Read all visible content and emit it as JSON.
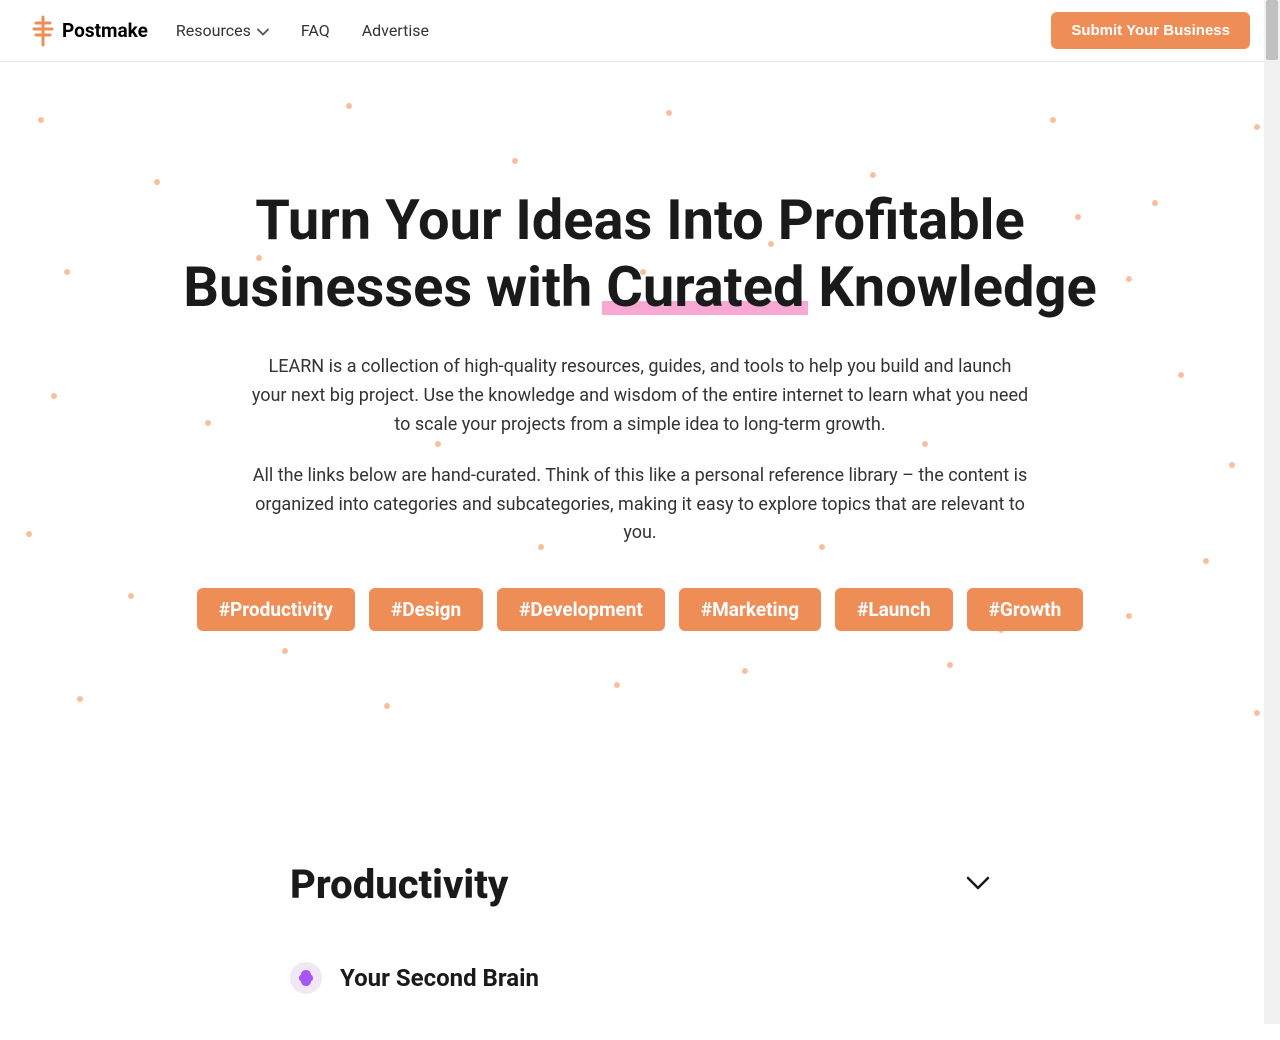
{
  "header": {
    "logo_text": "Postmake",
    "nav": {
      "resources": "Resources",
      "faq": "FAQ",
      "advertise": "Advertise"
    },
    "submit_button": "Submit Your Business"
  },
  "hero": {
    "title_part1": "Turn Your Ideas Into Profitable Businesses with ",
    "title_highlight": "Curated",
    "title_part2": " Knowledge",
    "description1": "LEARN is a collection of high-quality resources, guides, and tools to help you build and launch your next big project. Use the knowledge and wisdom of the entire internet to learn what you need to scale your projects from a simple idea to long-term growth.",
    "description2": "All the links below are hand-curated. Think of this like a personal reference library – the content is organized into categories and subcategories, making it easy to explore topics that are relevant to you.",
    "tags": [
      "#Productivity",
      "#Design",
      "#Development",
      "#Marketing",
      "#Launch",
      "#Growth"
    ]
  },
  "section": {
    "title": "Productivity",
    "items": [
      {
        "title": "Your Second Brain"
      }
    ]
  },
  "colors": {
    "accent": "#ee8d56",
    "highlight": "#f9a8d4",
    "brain_icon": "#a855f7"
  }
}
